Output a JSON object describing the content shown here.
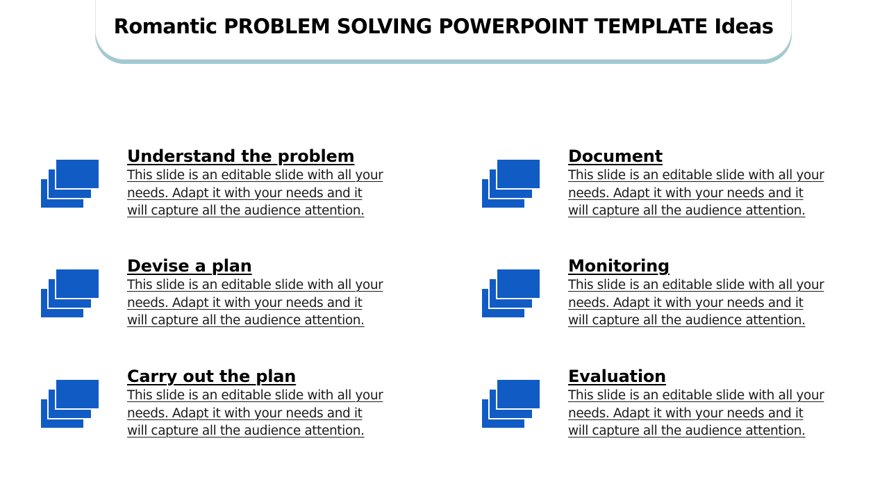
{
  "slide": {
    "title": "Romantic PROBLEM SOLVING POWERPOINT TEMPLATE Ideas"
  },
  "colors": {
    "icon_blue": "#115bc4",
    "banner_shadow": "#a2c9d1"
  },
  "items": [
    {
      "heading": "Understand the problem",
      "icon": "stacked-slides-icon",
      "body_lines": [
        "This slide is an editable slide with all your",
        "needs. Adapt it with your needs and it",
        "will capture  all the audience attention."
      ]
    },
    {
      "heading": "Devise a plan",
      "icon": "stacked-slides-icon",
      "body_lines": [
        "This slide is an editable slide with all your",
        "needs. Adapt it with your needs and it",
        "will capture  all the audience attention."
      ]
    },
    {
      "heading": "Carry out the plan",
      "icon": "stacked-slides-icon",
      "body_lines": [
        "This slide is an editable slide with all your",
        "needs. Adapt it with your needs and it",
        "will capture  all the audience attention."
      ]
    },
    {
      "heading": "Document",
      "icon": "stacked-slides-icon",
      "body_lines": [
        "This slide is an editable slide with all your",
        "needs. Adapt it with your needs and it",
        "will capture  all the audience attention."
      ]
    },
    {
      "heading": "Monitoring",
      "icon": "stacked-slides-icon",
      "body_lines": [
        "This slide is an editable slide with all your",
        "needs. Adapt it with your needs and it",
        "will capture  all the audience attention."
      ]
    },
    {
      "heading": "Evaluation",
      "icon": "stacked-slides-icon",
      "body_lines": [
        "This slide is an editable slide with all your",
        "needs. Adapt it with your needs and it",
        "will capture  all the audience attention."
      ]
    }
  ]
}
